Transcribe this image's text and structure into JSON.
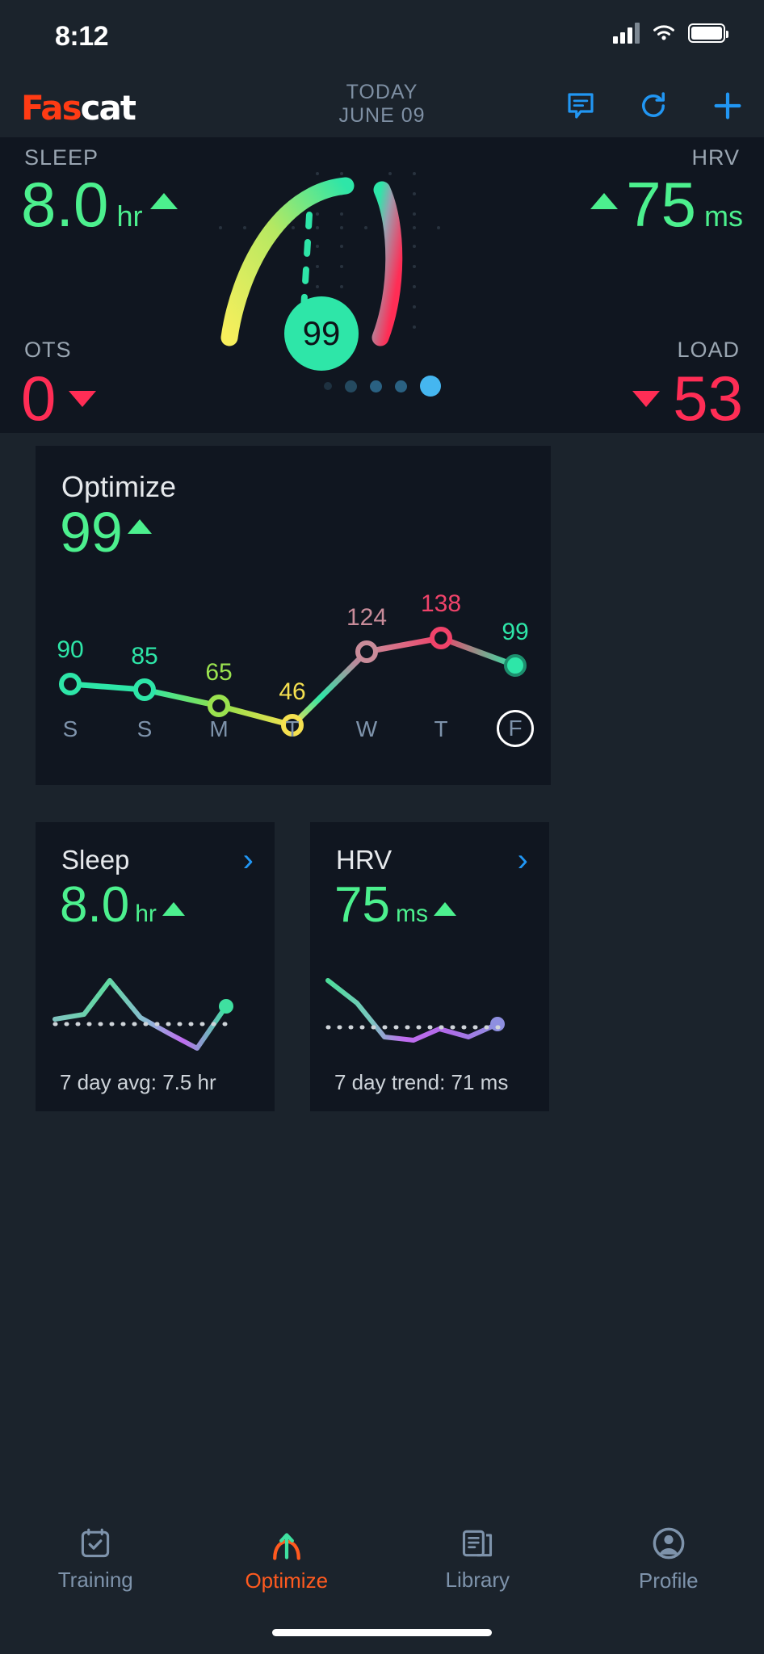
{
  "status_bar": {
    "time": "8:12",
    "signal_icon": "cellular-signal-icon",
    "wifi_icon": "wifi-icon",
    "battery_icon": "battery-icon"
  },
  "header": {
    "logo_part1": "Fas",
    "logo_part2": "cat",
    "date_line1": "TODAY",
    "date_line2": "JUNE 09",
    "icons": [
      "comment-icon",
      "refresh-icon",
      "plus-icon"
    ],
    "accent_color": "#2196f3",
    "brand_color": "#ff3b14"
  },
  "hero": {
    "sleep": {
      "label": "SLEEP",
      "value": "8.0",
      "unit": "hr",
      "trend": "up",
      "color": "#4cf08e"
    },
    "hrv": {
      "label": "HRV",
      "value": "75",
      "unit": "ms",
      "trend": "up",
      "color": "#4cf08e"
    },
    "ots": {
      "label": "OTS",
      "value": "0",
      "trend": "down",
      "color": "#ff2d55"
    },
    "load": {
      "label": "LOAD",
      "value": "53",
      "trend": "down",
      "color": "#ff2d55"
    },
    "score_bubble": "99",
    "page_dots": {
      "count": 5,
      "active_index": 4
    }
  },
  "optimize_card": {
    "title": "Optimize",
    "score": "99",
    "trend": "up",
    "today_label": "F"
  },
  "chart_data": {
    "type": "line",
    "title": "Optimize",
    "categories": [
      "S",
      "S",
      "M",
      "T",
      "W",
      "T",
      "F"
    ],
    "values": [
      90,
      85,
      65,
      46,
      124,
      138,
      99
    ],
    "point_labels": [
      "90",
      "85",
      "65",
      "46",
      "124",
      "138",
      "99"
    ],
    "point_colors": [
      "#2ee6a8",
      "#2ee6a8",
      "#86e04b",
      "#f5e050",
      "#c98c9a",
      "#f0436a",
      "#2ee6a8"
    ],
    "label_colors": [
      "#2ee6a8",
      "#2ee6a8",
      "#8fe04b",
      "#f5e050",
      "#c98c9a",
      "#f0436a",
      "#2ee6a8"
    ],
    "xlabel": "",
    "ylabel": "",
    "ylim": [
      30,
      150
    ],
    "grid": false,
    "legend": "none"
  },
  "sleep_card": {
    "title": "Sleep",
    "chevron_icon": "chevron-right-icon",
    "value": "8.0",
    "unit": "hr",
    "trend": "up",
    "footer": "7 day avg: 7.5 hr",
    "spark": {
      "type": "line",
      "values": [
        30,
        34,
        62,
        40,
        20,
        6,
        46
      ],
      "baseline": 28
    }
  },
  "hrv_card": {
    "title": "HRV",
    "chevron_icon": "chevron-right-icon",
    "value": "75",
    "unit": "ms",
    "trend": "up",
    "footer": "7 day trend: 71 ms",
    "spark": {
      "type": "line",
      "values": [
        62,
        44,
        14,
        12,
        28,
        20,
        34
      ],
      "baseline": 28
    }
  },
  "tabbar": {
    "items": [
      {
        "label": "Training",
        "icon": "calendar-check-icon",
        "active": false
      },
      {
        "label": "Optimize",
        "icon": "arch-arrow-icon",
        "active": true
      },
      {
        "label": "Library",
        "icon": "books-icon",
        "active": false
      },
      {
        "label": "Profile",
        "icon": "person-circle-icon",
        "active": false
      }
    ],
    "active_color": "#ff5a1f",
    "inactive_color": "#7e93ab"
  }
}
